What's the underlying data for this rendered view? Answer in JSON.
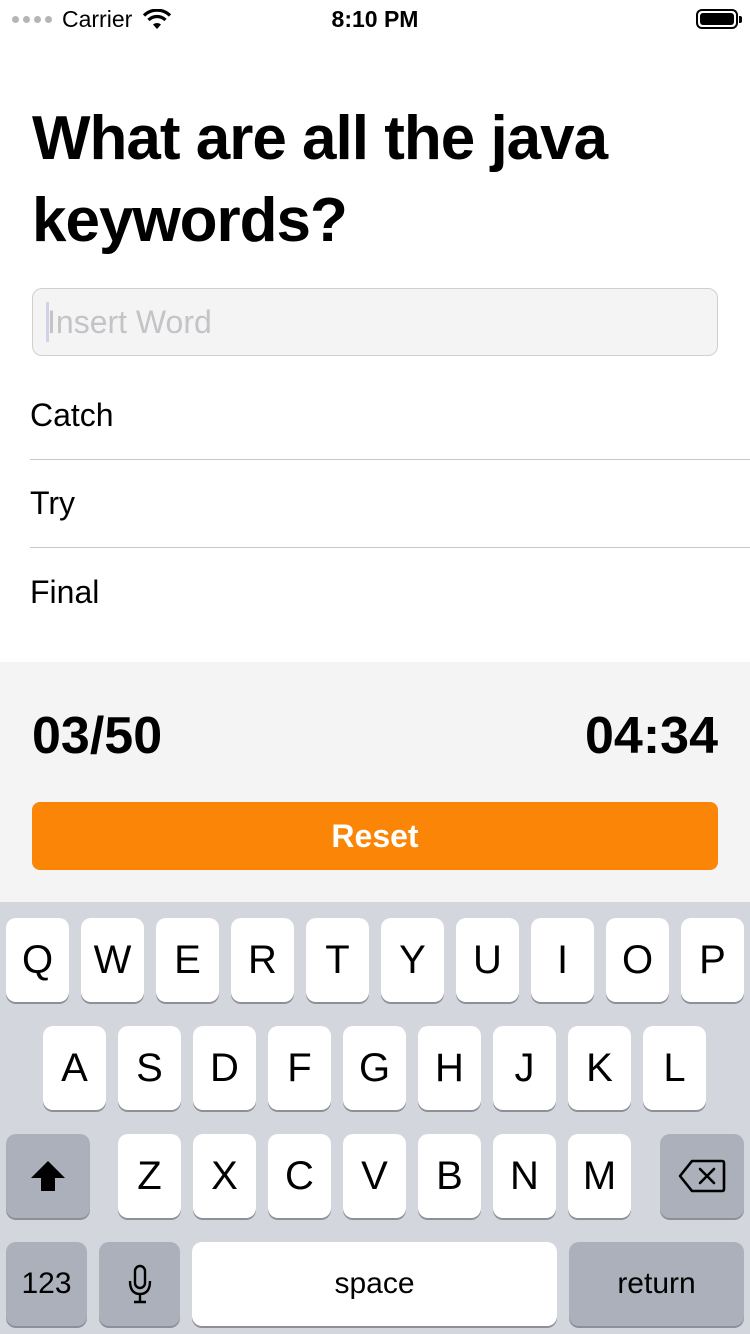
{
  "status_bar": {
    "carrier": "Carrier",
    "time": "8:10 PM"
  },
  "quiz": {
    "title": "What are all the java keywords?",
    "input_placeholder": "Insert Word",
    "input_value": "",
    "answers": [
      "Catch",
      "Try",
      "Final"
    ],
    "score": "03/50",
    "timer": "04:34",
    "reset_label": "Reset",
    "reset_color": "#fb8506"
  },
  "keyboard": {
    "row1": [
      "Q",
      "W",
      "E",
      "R",
      "T",
      "Y",
      "U",
      "I",
      "O",
      "P"
    ],
    "row2": [
      "A",
      "S",
      "D",
      "F",
      "G",
      "H",
      "J",
      "K",
      "L"
    ],
    "row3": [
      "Z",
      "X",
      "C",
      "V",
      "B",
      "N",
      "M"
    ],
    "numbers_label": "123",
    "space_label": "space",
    "return_label": "return"
  }
}
